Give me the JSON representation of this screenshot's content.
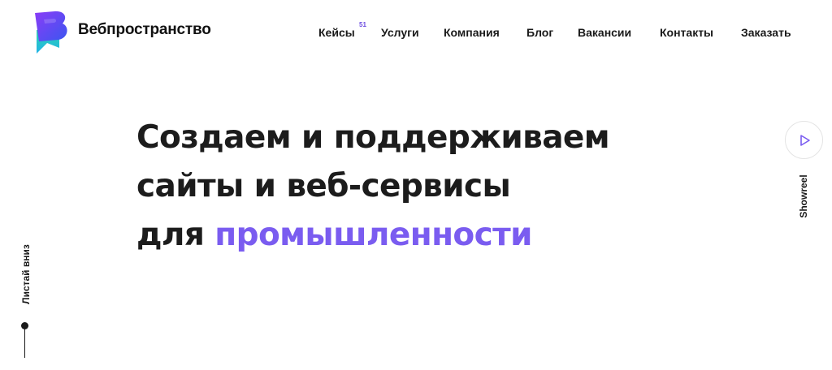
{
  "brand": {
    "name": "Вебпространство",
    "logo_icon": "b-letter-logo-icon"
  },
  "nav": {
    "cases": {
      "label": "Кейсы",
      "count": "51"
    },
    "services": "Услуги",
    "company": "Компания",
    "blog": "Блог",
    "vacancies": "Вакансии",
    "contacts": "Контакты",
    "order": "Заказать"
  },
  "hero": {
    "line1": "Создаем и поддерживаем",
    "line2": "сайты и веб-сервисы",
    "line3_prefix": "для ",
    "line3_accent": "промышленности"
  },
  "showreel": {
    "label": "Showreel",
    "icon": "play-icon"
  },
  "scroll": {
    "label": "Листай вниз"
  },
  "colors": {
    "accent": "#7a5cf0",
    "text": "#1a1a1a",
    "background": "#ffffff"
  }
}
